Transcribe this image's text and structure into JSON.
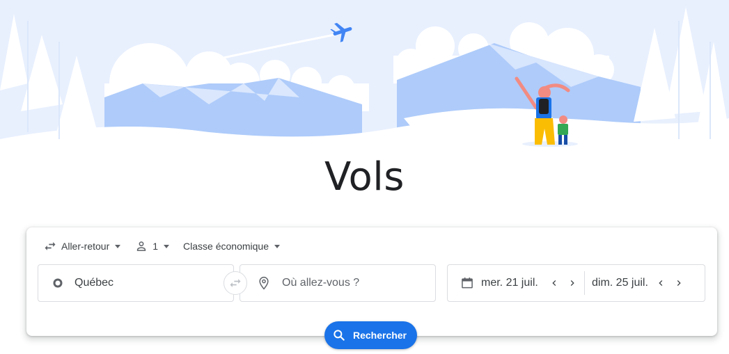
{
  "page": {
    "title": "Vols"
  },
  "options": {
    "trip_type": "Aller-retour",
    "passengers": "1",
    "cabin_class": "Classe économique"
  },
  "fields": {
    "origin": "Québec",
    "destination_placeholder": "Où allez-vous ?",
    "departure_date": "mer. 21 juil.",
    "return_date": "dim. 25 juil."
  },
  "search": {
    "label": "Rechercher"
  },
  "icons": {
    "trip_type": "swap-horiz-icon",
    "passengers": "person-icon",
    "origin": "origin-circle-icon",
    "swap": "swap-arrows-icon",
    "destination": "location-pin-icon",
    "date": "calendar-icon",
    "search": "search-icon"
  },
  "colors": {
    "accent": "#1a73e8",
    "sky": "#e8f0fe",
    "mountain": "#aecbfa",
    "text": "#3c4043"
  }
}
